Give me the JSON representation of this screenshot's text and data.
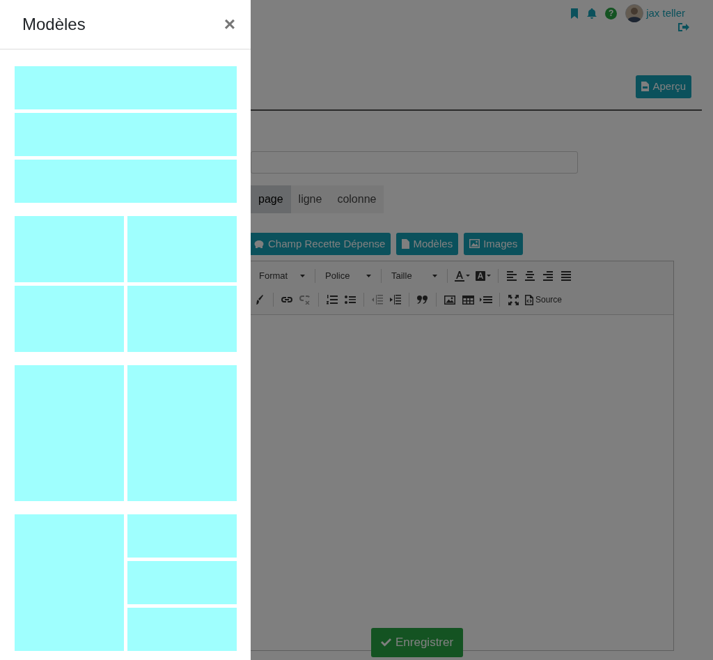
{
  "panel": {
    "title": "Modèles",
    "close": "×",
    "templates": [
      {
        "kind": "three-rows"
      },
      {
        "kind": "two-by-two"
      },
      {
        "kind": "two-columns"
      },
      {
        "kind": "column-and-three-rows"
      }
    ]
  },
  "header": {
    "help": "?",
    "user": "jax teller"
  },
  "preview_button": "Aperçu",
  "tabs": [
    {
      "label": "page",
      "selected": true
    },
    {
      "label": "ligne",
      "selected": false
    },
    {
      "label": "colonne",
      "selected": false
    }
  ],
  "insert_buttons": [
    "Champ Recette Dépense",
    "Modèles",
    "Images"
  ],
  "editor": {
    "dropdowns": [
      "Format",
      "Police",
      "Taille"
    ],
    "source_button": "Source"
  },
  "save_button": "Enregistrer"
}
